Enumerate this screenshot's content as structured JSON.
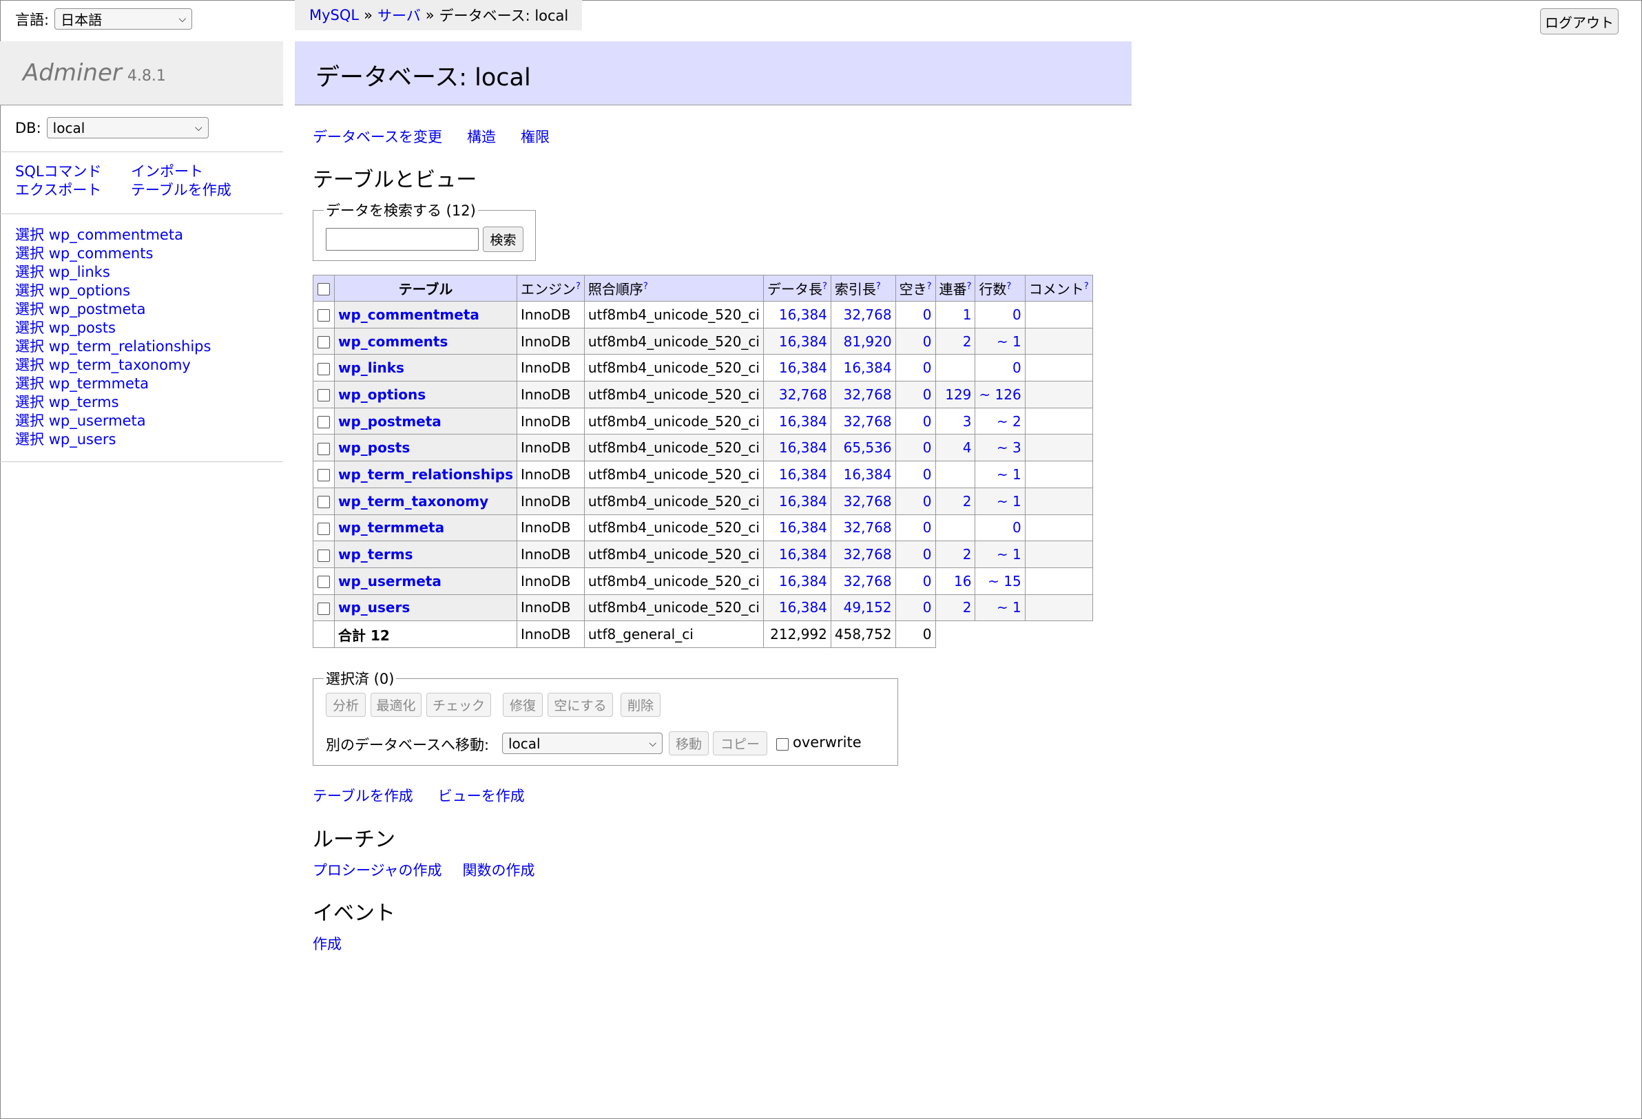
{
  "language": {
    "label": "言語:",
    "selected": "日本語"
  },
  "logo": {
    "name": "Adminer",
    "version": "4.8.1"
  },
  "db": {
    "label": "DB:",
    "selected": "local"
  },
  "menu": {
    "sql": "SQLコマンド",
    "import": "インポート",
    "export": "エクスポート",
    "create_table": "テーブルを作成"
  },
  "sidebar_tables": [
    {
      "prefix": "選択",
      "name": "wp_commentmeta"
    },
    {
      "prefix": "選択",
      "name": "wp_comments"
    },
    {
      "prefix": "選択",
      "name": "wp_links"
    },
    {
      "prefix": "選択",
      "name": "wp_options"
    },
    {
      "prefix": "選択",
      "name": "wp_postmeta"
    },
    {
      "prefix": "選択",
      "name": "wp_posts"
    },
    {
      "prefix": "選択",
      "name": "wp_term_relationships"
    },
    {
      "prefix": "選択",
      "name": "wp_term_taxonomy"
    },
    {
      "prefix": "選択",
      "name": "wp_termmeta"
    },
    {
      "prefix": "選択",
      "name": "wp_terms"
    },
    {
      "prefix": "選択",
      "name": "wp_usermeta"
    },
    {
      "prefix": "選択",
      "name": "wp_users"
    }
  ],
  "breadcrumb": {
    "mysql": "MySQL",
    "sep": "»",
    "server": "サーバ",
    "current": "データベース: local"
  },
  "logout": "ログアウト",
  "page_title": "データベース: local",
  "top_links": {
    "alter_db": "データベースを変更",
    "schema": "構造",
    "privileges": "権限"
  },
  "tables_heading": "テーブルとビュー",
  "search": {
    "legend": "データを検索する (12)",
    "value": "",
    "button": "検索"
  },
  "table": {
    "headers": {
      "name": "テーブル",
      "engine": "エンジン",
      "collation": "照合順序",
      "data_length": "データ長",
      "index_length": "索引長",
      "free": "空き",
      "auto_inc": "連番",
      "rows": "行数",
      "comment": "コメント",
      "help": "?"
    },
    "rows": [
      {
        "name": "wp_commentmeta",
        "engine": "InnoDB",
        "collation": "utf8mb4_unicode_520_ci",
        "data": "16,384",
        "index": "32,768",
        "free": "0",
        "auto": "1",
        "rows": "0",
        "comment": ""
      },
      {
        "name": "wp_comments",
        "engine": "InnoDB",
        "collation": "utf8mb4_unicode_520_ci",
        "data": "16,384",
        "index": "81,920",
        "free": "0",
        "auto": "2",
        "rows": "~ 1",
        "comment": ""
      },
      {
        "name": "wp_links",
        "engine": "InnoDB",
        "collation": "utf8mb4_unicode_520_ci",
        "data": "16,384",
        "index": "16,384",
        "free": "0",
        "auto": "",
        "rows": "0",
        "comment": ""
      },
      {
        "name": "wp_options",
        "engine": "InnoDB",
        "collation": "utf8mb4_unicode_520_ci",
        "data": "32,768",
        "index": "32,768",
        "free": "0",
        "auto": "129",
        "rows": "~ 126",
        "comment": ""
      },
      {
        "name": "wp_postmeta",
        "engine": "InnoDB",
        "collation": "utf8mb4_unicode_520_ci",
        "data": "16,384",
        "index": "32,768",
        "free": "0",
        "auto": "3",
        "rows": "~ 2",
        "comment": ""
      },
      {
        "name": "wp_posts",
        "engine": "InnoDB",
        "collation": "utf8mb4_unicode_520_ci",
        "data": "16,384",
        "index": "65,536",
        "free": "0",
        "auto": "4",
        "rows": "~ 3",
        "comment": ""
      },
      {
        "name": "wp_term_relationships",
        "engine": "InnoDB",
        "collation": "utf8mb4_unicode_520_ci",
        "data": "16,384",
        "index": "16,384",
        "free": "0",
        "auto": "",
        "rows": "~ 1",
        "comment": ""
      },
      {
        "name": "wp_term_taxonomy",
        "engine": "InnoDB",
        "collation": "utf8mb4_unicode_520_ci",
        "data": "16,384",
        "index": "32,768",
        "free": "0",
        "auto": "2",
        "rows": "~ 1",
        "comment": ""
      },
      {
        "name": "wp_termmeta",
        "engine": "InnoDB",
        "collation": "utf8mb4_unicode_520_ci",
        "data": "16,384",
        "index": "32,768",
        "free": "0",
        "auto": "",
        "rows": "0",
        "comment": ""
      },
      {
        "name": "wp_terms",
        "engine": "InnoDB",
        "collation": "utf8mb4_unicode_520_ci",
        "data": "16,384",
        "index": "32,768",
        "free": "0",
        "auto": "2",
        "rows": "~ 1",
        "comment": ""
      },
      {
        "name": "wp_usermeta",
        "engine": "InnoDB",
        "collation": "utf8mb4_unicode_520_ci",
        "data": "16,384",
        "index": "32,768",
        "free": "0",
        "auto": "16",
        "rows": "~ 15",
        "comment": ""
      },
      {
        "name": "wp_users",
        "engine": "InnoDB",
        "collation": "utf8mb4_unicode_520_ci",
        "data": "16,384",
        "index": "49,152",
        "free": "0",
        "auto": "2",
        "rows": "~ 1",
        "comment": ""
      }
    ],
    "total": {
      "label": "合計 12",
      "engine": "InnoDB",
      "collation": "utf8_general_ci",
      "data": "212,992",
      "index": "458,752",
      "free": "0"
    }
  },
  "selected": {
    "legend": "選択済 (0)",
    "buttons": {
      "analyze": "分析",
      "optimize": "最適化",
      "check": "チェック",
      "repair": "修復",
      "truncate": "空にする",
      "drop": "削除"
    },
    "move_label": "別のデータベースへ移動:",
    "target_db": "local",
    "move": "移動",
    "copy": "コピー",
    "overwrite": "overwrite"
  },
  "create_links": {
    "table": "テーブルを作成",
    "view": "ビューを作成"
  },
  "routines": {
    "heading": "ルーチン",
    "procedure": "プロシージャの作成",
    "function": "関数の作成"
  },
  "events": {
    "heading": "イベント",
    "create": "作成"
  }
}
